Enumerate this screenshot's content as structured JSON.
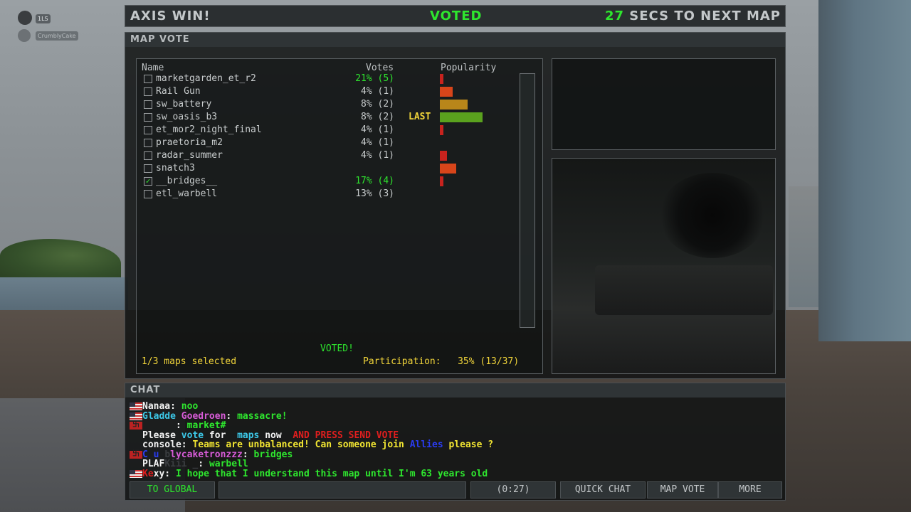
{
  "player": {
    "badge": "1LS",
    "name": "CrumblyCake"
  },
  "topbar": {
    "result": "AXIS WIN!",
    "status": "VOTED",
    "countdown_number": "27",
    "countdown_text": " SECS TO NEXT MAP"
  },
  "map_vote": {
    "title": "MAP VOTE",
    "headers": {
      "name": "Name",
      "votes": "Votes",
      "popularity": "Popularity"
    },
    "maps": [
      {
        "name": "marketgarden_et_r2",
        "votes": "21% (5)",
        "checked": false,
        "highlight": true,
        "popularity": 0.09,
        "bar_color": "#c8231e"
      },
      {
        "name": "Rail Gun",
        "votes": "4% (1)",
        "checked": false,
        "highlight": false,
        "popularity": 0.3,
        "bar_color": "#d8451a"
      },
      {
        "name": "sw_battery",
        "votes": "8% (2)",
        "checked": false,
        "highlight": false,
        "popularity": 0.65,
        "bar_color": "#b8861a"
      },
      {
        "name": "sw_oasis_b3",
        "votes": "8% (2)",
        "checked": false,
        "highlight": false,
        "popularity": 1.0,
        "bar_color": "#5aa21e",
        "last": "LAST"
      },
      {
        "name": "et_mor2_night_final",
        "votes": "4% (1)",
        "checked": false,
        "highlight": false,
        "popularity": 0.09,
        "bar_color": "#c8231e"
      },
      {
        "name": "praetoria_m2",
        "votes": "4% (1)",
        "checked": false,
        "highlight": false,
        "popularity": 0,
        "bar_color": "#c8231e"
      },
      {
        "name": "radar_summer",
        "votes": "4% (1)",
        "checked": false,
        "highlight": false,
        "popularity": 0.16,
        "bar_color": "#c8231e"
      },
      {
        "name": "snatch3",
        "votes": "",
        "checked": false,
        "highlight": false,
        "popularity": 0.38,
        "bar_color": "#d8451a"
      },
      {
        "name": "__bridges__",
        "votes": "17% (4)",
        "checked": true,
        "highlight": true,
        "popularity": 0.09,
        "bar_color": "#c8231e"
      },
      {
        "name": "etl_warbell",
        "votes": "13% (3)",
        "checked": false,
        "highlight": false,
        "popularity": 0,
        "bar_color": "#c8231e"
      }
    ],
    "voted_message": "VOTED!",
    "selected_text": "1/3 maps selected",
    "participation_label": "Participation:",
    "participation_value": "35% (13/37)"
  },
  "chat": {
    "title": "CHAT",
    "buttons": {
      "to_global": "TO GLOBAL",
      "timer": "(0:27)",
      "quick_chat": "QUICK CHAT",
      "map_vote": "MAP VOTE",
      "more": "MORE"
    },
    "flag_us": "us-flag-icon",
    "flag_axis": "axis-flag-icon"
  }
}
